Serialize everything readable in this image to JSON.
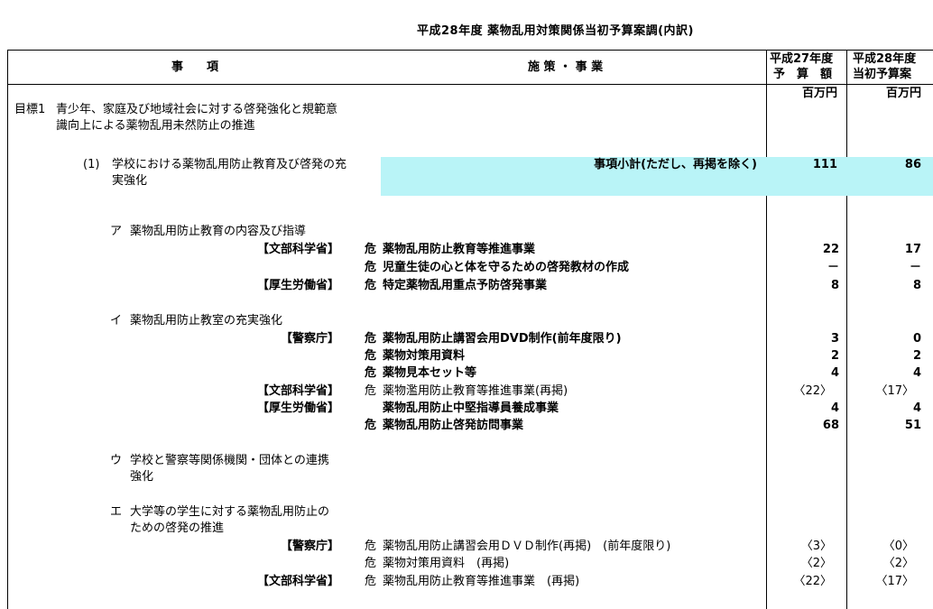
{
  "title": "平成28年度 薬物乱用対策関係当初予算案調(内訳)",
  "header": {
    "col1": "事　　項",
    "col2": "施 策 ・ 事 業",
    "col3_line1": "平成27年度",
    "col3_line2": "予　算　額",
    "col4_line1": "平成28年度",
    "col4_line2": "当初予算案"
  },
  "units": {
    "col3": "百万円",
    "col4": "百万円"
  },
  "goal1": {
    "label": "目標1",
    "text": "青少年、家庭及び地域社会に対する啓発強化と規範意識向上による薬物乱用未然防止の推進"
  },
  "sub1": {
    "label": "(1)",
    "text": "学校における薬物乱用防止教育及び啓発の充実強化"
  },
  "subtotal": {
    "label": "事項小計(ただし、再掲を除く)",
    "fy27": "111",
    "fy28": "86"
  },
  "item_a": {
    "label": "ア",
    "text": "薬物乱用防止教育の内容及び指導"
  },
  "item_i": {
    "label": "イ",
    "text": "薬物乱用防止教室の充実強化"
  },
  "item_u": {
    "label": "ウ",
    "text": "学校と警察等関係機関・団体との連携強化"
  },
  "item_e": {
    "label": "エ",
    "text": "大学等の学生に対する薬物乱用防止のための啓発の推進"
  },
  "rows": [
    {
      "ministry": "【文部科学省】",
      "mark": "危",
      "name": "薬物乱用防止教育等推進事業",
      "fy27": "22",
      "fy28": "17",
      "bold": true
    },
    {
      "ministry": "",
      "mark": "危",
      "name": "児童生徒の心と体を守るための啓発教材の作成",
      "fy27": "－",
      "fy28": "－",
      "bold": true
    },
    {
      "ministry": "【厚生労働省】",
      "mark": "危",
      "name": "特定薬物乱用重点予防啓発事業",
      "fy27": "8",
      "fy28": "8",
      "bold": true
    },
    {
      "ministry": "【警察庁】",
      "mark": "危",
      "name": "薬物乱用防止講習会用DVD制作(前年度限り)",
      "fy27": "3",
      "fy28": "0",
      "bold": true
    },
    {
      "ministry": "",
      "mark": "危",
      "name": "薬物対策用資料",
      "fy27": "2",
      "fy28": "2",
      "bold": true
    },
    {
      "ministry": "",
      "mark": "危",
      "name": "薬物見本セット等",
      "fy27": "4",
      "fy28": "4",
      "bold": true
    },
    {
      "ministry": "【文部科学省】",
      "mark": "危",
      "name": "薬物濫用防止教育等推進事業(再掲)",
      "fy27": "〈22〉",
      "fy28": "〈17〉",
      "bold": false
    },
    {
      "ministry": "【厚生労働省】",
      "mark": "",
      "name": "薬物乱用防止中堅指導員養成事業",
      "fy27": "4",
      "fy28": "4",
      "bold": true
    },
    {
      "ministry": "",
      "mark": "危",
      "name": "薬物乱用防止啓発訪問事業",
      "fy27": "68",
      "fy28": "51",
      "bold": true
    },
    {
      "ministry": "【警察庁】",
      "mark": "危",
      "name": "薬物乱用防止講習会用ＤＶＤ制作(再掲)　(前年度限り)",
      "fy27": "〈3〉",
      "fy28": "〈0〉",
      "bold": false
    },
    {
      "ministry": "",
      "mark": "危",
      "name": "薬物対策用資料　(再掲)",
      "fy27": "〈2〉",
      "fy28": "〈2〉",
      "bold": false
    },
    {
      "ministry": "【文部科学省】",
      "mark": "危",
      "name": "薬物乱用防止教育等推進事業　(再掲)",
      "fy27": "〈22〉",
      "fy28": "〈17〉",
      "bold": false
    }
  ]
}
